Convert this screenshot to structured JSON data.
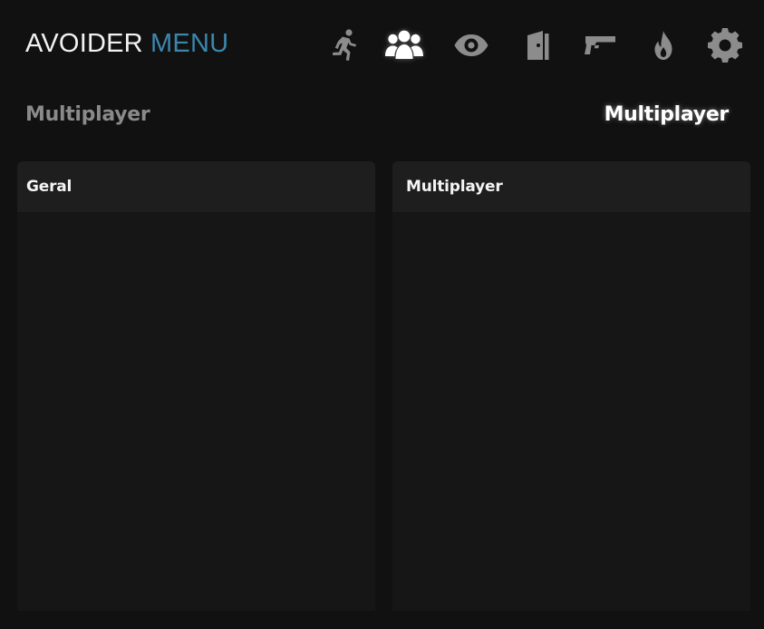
{
  "header": {
    "brand_primary": "AVOIDER",
    "brand_secondary": "MENU",
    "brand_secondary_color": "#3b86ad",
    "nav_icons": [
      {
        "name": "runner-icon",
        "active": false
      },
      {
        "name": "users-icon",
        "active": true
      },
      {
        "name": "eye-icon",
        "active": false
      },
      {
        "name": "door-icon",
        "active": false
      },
      {
        "name": "pistol-icon",
        "active": false
      },
      {
        "name": "flame-icon",
        "active": false
      },
      {
        "name": "gear-icon",
        "active": false
      }
    ]
  },
  "subheader": {
    "left_title": "Multiplayer",
    "right_title": "Multiplayer"
  },
  "panels": [
    {
      "title": "Geral"
    },
    {
      "title": "Multiplayer"
    }
  ],
  "colors": {
    "background": "#111111",
    "panel": "#161616",
    "panel_header": "#1e1e1e",
    "icon_inactive": "#8c8c8c",
    "icon_active": "#ffffff"
  }
}
